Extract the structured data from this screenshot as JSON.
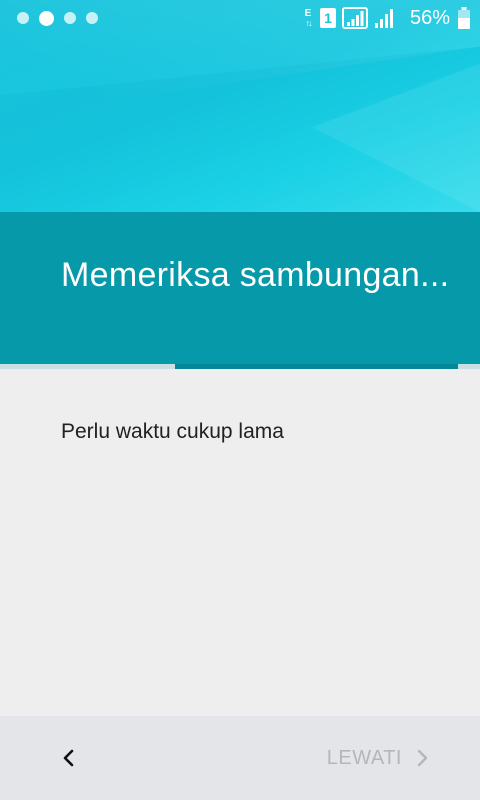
{
  "status_bar": {
    "network_type": "E",
    "sim_slot": "1",
    "battery_percent": "56%",
    "icons": [
      "page-dot-icon",
      "signal-icon",
      "battery-icon"
    ]
  },
  "header": {
    "title": "Memeriksa sambungan..."
  },
  "progress": {
    "fraction": 0.59,
    "color": "#05879a"
  },
  "content": {
    "message": "Perlu waktu cukup lama"
  },
  "footer": {
    "back_icon": "chevron-left-icon",
    "skip_label": "LEWATI",
    "skip_icon": "chevron-right-icon"
  },
  "colors": {
    "accent": "#1bc4dc",
    "title_band": "#0599a9",
    "background": "#eeeeee",
    "footer": "#e3e5e8",
    "disabled_text": "#b4b6b8"
  }
}
